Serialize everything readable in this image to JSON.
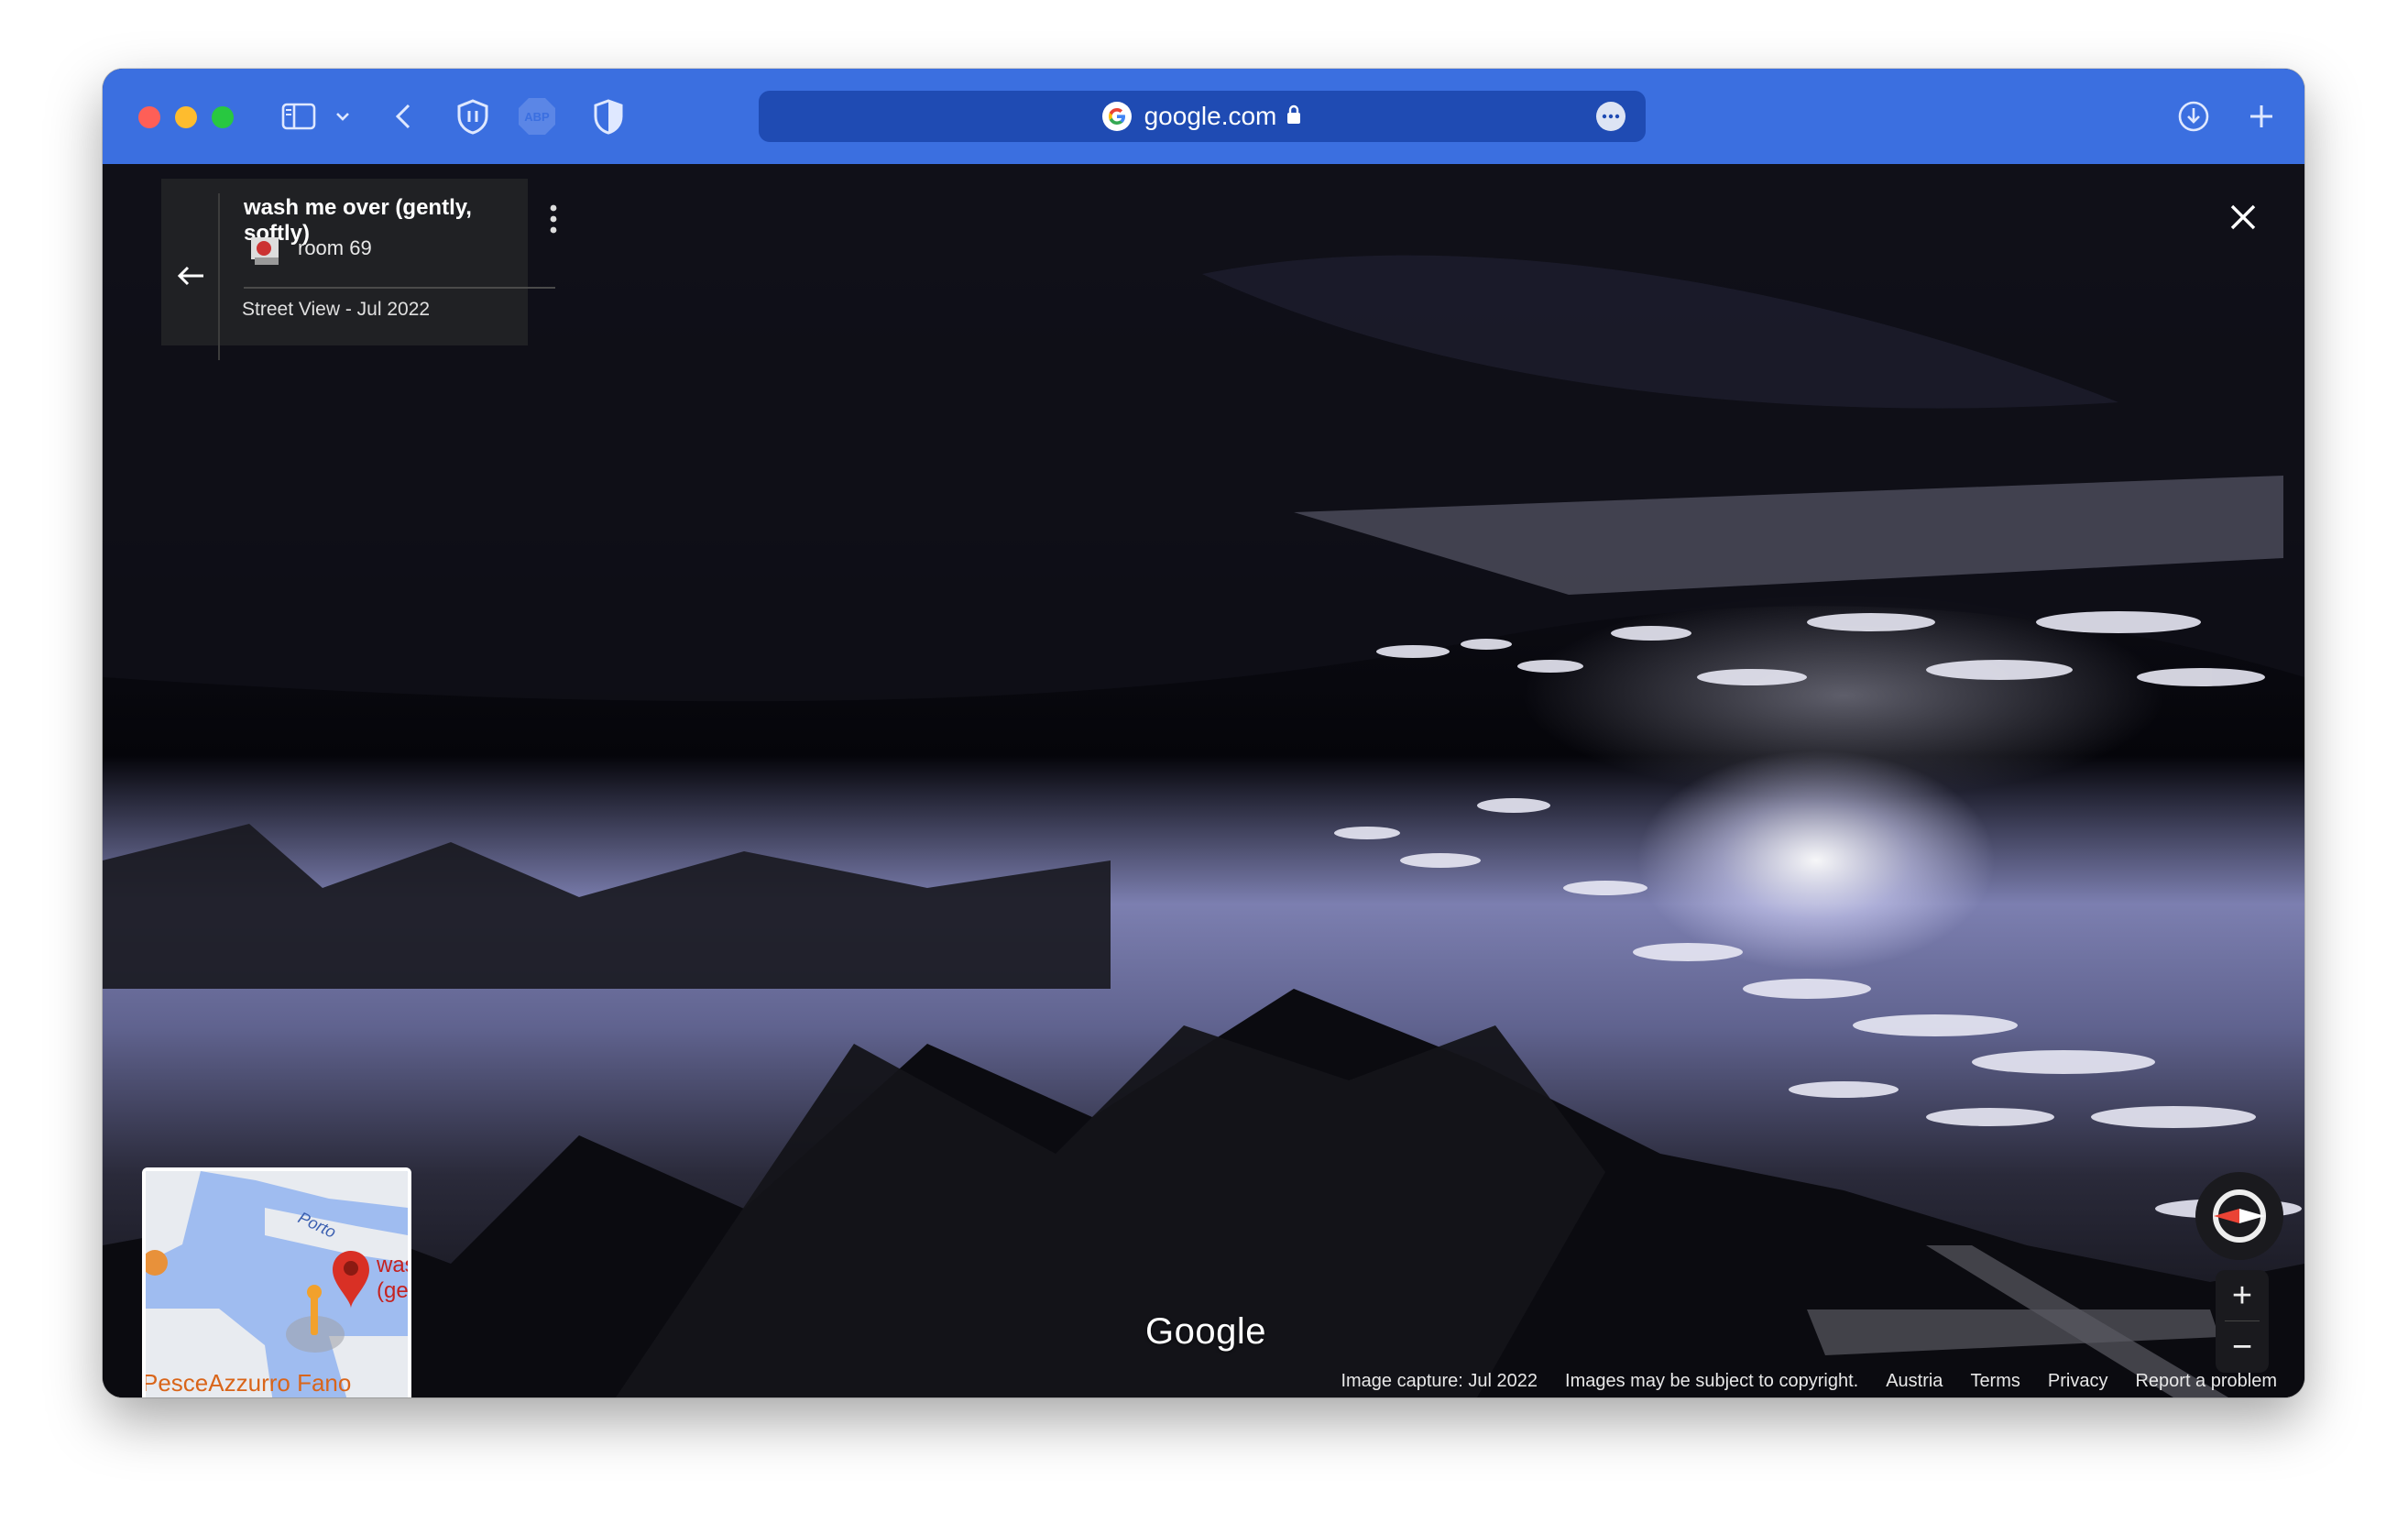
{
  "browser": {
    "url": "google.com",
    "toolbar_icons": [
      "sidebar-icon",
      "chevron-down-icon",
      "back-icon",
      "shield-pause-icon",
      "abp-icon",
      "privacy-shield-icon",
      "download-icon",
      "plus-icon"
    ],
    "abp_label": "ABP",
    "accent_color": "#3b6fe0"
  },
  "street_view": {
    "title": "wash me over (gently, softly)",
    "author": "room 69",
    "capture_label": "Street View - Jul 2022"
  },
  "minimap": {
    "street_label": "Porto",
    "place_name": "PesceAzzurro Fano",
    "pin_label_line1": "was",
    "pin_label_line2": "(ger"
  },
  "controls": {
    "zoom_in": "+",
    "zoom_out": "−"
  },
  "footer": {
    "logo": "Google",
    "image_capture": "Image capture: Jul 2022",
    "copyright": "Images may be subject to copyright.",
    "country": "Austria",
    "terms": "Terms",
    "privacy": "Privacy",
    "report": "Report a problem"
  }
}
